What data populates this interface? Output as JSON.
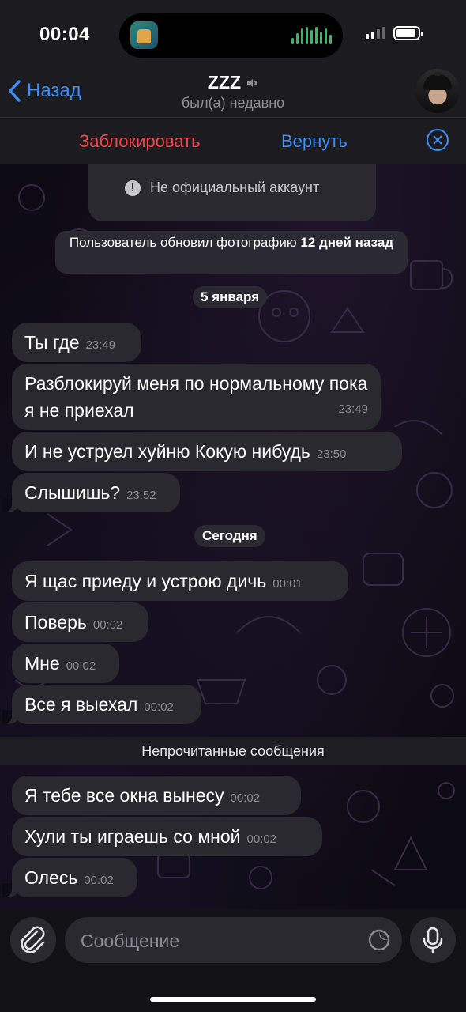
{
  "status_bar": {
    "time": "00:04"
  },
  "header": {
    "back_label": "Назад",
    "chat_name": "ZZZ",
    "status": "был(а) недавно"
  },
  "actions": {
    "block": "Заблокировать",
    "return": "Вернуть"
  },
  "info_card": {
    "text": "Не официальный аккаунт"
  },
  "service": {
    "photo_update_prefix": "Пользователь обновил фотографию",
    "photo_update_bold": "12 дней назад"
  },
  "dates": {
    "jan5": "5 января",
    "today": "Сегодня"
  },
  "messages": [
    {
      "text": "Ты где",
      "time": "23:49"
    },
    {
      "text": "Разблокируй меня по нормальному пока я не приехал",
      "time": "23:49"
    },
    {
      "text": "И не уструел хуйню Кокую нибудь",
      "time": "23:50"
    },
    {
      "text": "Слышишь?",
      "time": "23:52"
    },
    {
      "text": "Я щас приеду и устрою дичь",
      "time": "00:01"
    },
    {
      "text": "Поверь",
      "time": "00:02"
    },
    {
      "text": "Мне",
      "time": "00:02"
    },
    {
      "text": "Все я выехал",
      "time": "00:02"
    },
    {
      "text": "Я тебе все окна вынесу",
      "time": "00:02"
    },
    {
      "text": "Хули ты играешь со мной",
      "time": "00:02"
    },
    {
      "text": "Олесь",
      "time": "00:02"
    }
  ],
  "unread_label": "Непрочитанные сообщения",
  "input": {
    "placeholder": "Сообщение"
  },
  "icons": {
    "back": "chevron-left-icon",
    "muted": "speaker-muted-icon",
    "close": "close-circle-icon",
    "warning": "exclamation-circle-icon",
    "attach": "paperclip-icon",
    "sticker": "sticker-icon",
    "mic": "microphone-icon"
  },
  "colors": {
    "accent": "#3a8ef6",
    "danger": "#f0474a",
    "bubble": "#2a2930"
  }
}
